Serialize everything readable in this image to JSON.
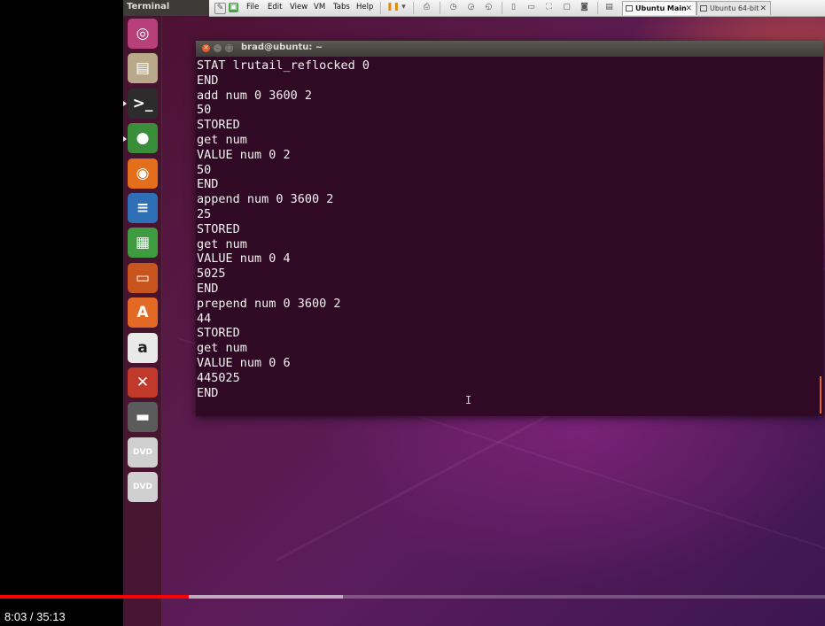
{
  "top_panel": {
    "app_name": "Terminal"
  },
  "vm_toolbar": {
    "menus": [
      "File",
      "Edit",
      "View",
      "VM",
      "Tabs",
      "Help"
    ],
    "tabs": [
      {
        "label": "Ubuntu Main",
        "active": true
      },
      {
        "label": "Ubuntu 64-bit",
        "active": false
      }
    ]
  },
  "launcher": {
    "items": [
      {
        "name": "ubuntu-dash",
        "glyph": "◎",
        "color": "#b7407a"
      },
      {
        "name": "files",
        "glyph": "▤",
        "color": "#b9a98a"
      },
      {
        "name": "terminal",
        "glyph": ">_",
        "color": "#2c2c2c"
      },
      {
        "name": "chrome",
        "glyph": "●",
        "color": "#3a8e3a"
      },
      {
        "name": "firefox",
        "glyph": "◉",
        "color": "#e36f1c"
      },
      {
        "name": "writer",
        "glyph": "≡",
        "color": "#2f6fb5"
      },
      {
        "name": "calc",
        "glyph": "▦",
        "color": "#3f9b3f"
      },
      {
        "name": "impress",
        "glyph": "▭",
        "color": "#c8541e"
      },
      {
        "name": "software-center",
        "glyph": "A",
        "color": "#e36a25"
      },
      {
        "name": "amazon",
        "glyph": "a",
        "color": "#e9e9e9"
      },
      {
        "name": "settings",
        "glyph": "✕",
        "color": "#c0392b"
      },
      {
        "name": "drive",
        "glyph": "▬",
        "color": "#5b5b5b"
      },
      {
        "name": "dvd-1",
        "glyph": "DVD",
        "color": "#d0d0d0"
      },
      {
        "name": "dvd-2",
        "glyph": "DVD",
        "color": "#d0d0d0"
      }
    ]
  },
  "terminal": {
    "title": "brad@ubuntu: ~",
    "lines": [
      "STAT lrutail_reflocked 0",
      "END",
      "add num 0 3600 2",
      "50",
      "STORED",
      "get num",
      "VALUE num 0 2",
      "50",
      "END",
      "append num 0 3600 2",
      "25",
      "STORED",
      "get num",
      "VALUE num 0 4",
      "5025",
      "END",
      "prepend num 0 3600 2",
      "44",
      "STORED",
      "get num",
      "VALUE num 0 6",
      "445025",
      "END"
    ]
  },
  "player": {
    "time_display": "8:03 / 35:13",
    "played_fraction": 0.229,
    "buffered_fraction": 0.416
  }
}
